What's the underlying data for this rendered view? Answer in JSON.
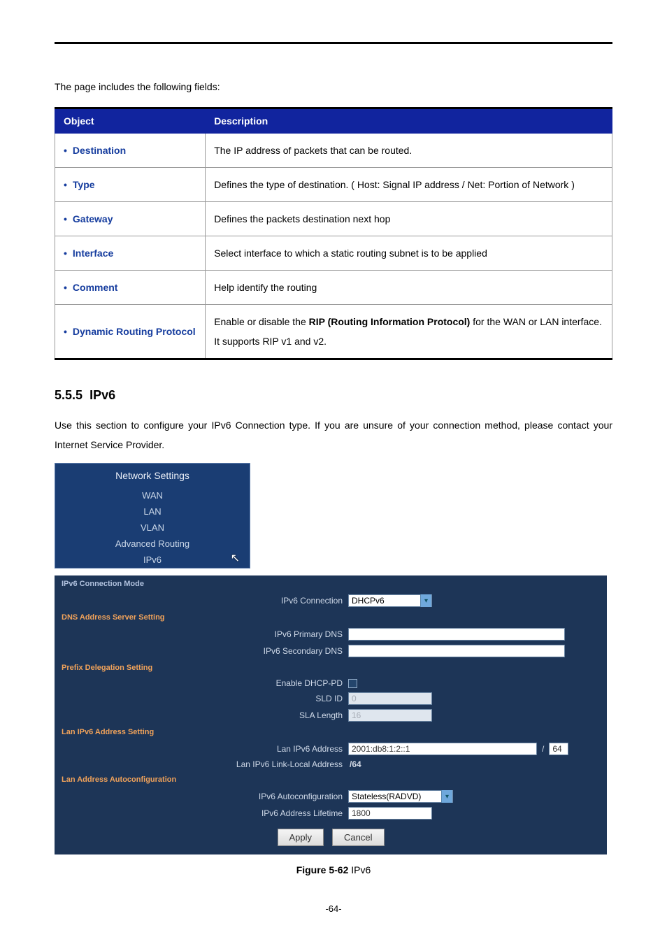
{
  "intro": "The page includes the following fields:",
  "tableHeader": {
    "object": "Object",
    "description": "Description"
  },
  "rows": [
    {
      "obj": "Destination",
      "desc": "The IP address of packets that can be routed."
    },
    {
      "obj": "Type",
      "desc_pre": "Defines the type of destination. ( Host: Signal IP address / Net: Portion of Network )"
    },
    {
      "obj": "Gateway",
      "desc": "Defines the packets destination next hop"
    },
    {
      "obj": "Interface",
      "desc": "Select interface to which a static routing subnet is to be applied"
    },
    {
      "obj": "Comment",
      "desc": "Help identify the routing"
    },
    {
      "obj": "Dynamic Routing Protocol",
      "desc_pre": "Enable or disable the ",
      "desc_bold": "RIP (Routing Information Protocol)",
      "desc_post": " for the WAN or LAN interface.",
      "desc_line2": "It supports RIP v1 and v2."
    }
  ],
  "section": {
    "number": "5.5.5",
    "title": "IPv6",
    "body": "Use this section to configure your IPv6 Connection type. If you are unsure of your connection method, please contact your Internet Service Provider."
  },
  "nav": {
    "header": "Network Settings",
    "items": [
      "WAN",
      "LAN",
      "VLAN",
      "Advanced Routing",
      "IPv6"
    ]
  },
  "panel": {
    "sec1": "IPv6 Connection Mode",
    "ipv6conn_label": "IPv6 Connection",
    "ipv6conn_value": "DHCPv6",
    "sec2": "DNS Address Server Setting",
    "dns1_label": "IPv6 Primary DNS",
    "dns2_label": "IPv6 Secondary DNS",
    "sec3": "Prefix Delegation Setting",
    "pd_label": "Enable DHCP-PD",
    "sld_label": "SLD ID",
    "sld_value": "0",
    "sla_label": "SLA Length",
    "sla_value": "16",
    "sec4": "Lan IPv6 Address Setting",
    "lan_addr_label": "Lan IPv6 Address",
    "lan_addr_value": "2001:db8:1:2::1",
    "lan_addr_suffix": "64",
    "lan_ll_label": "Lan IPv6 Link-Local Address",
    "lan_ll_value": "/64",
    "sec5": "Lan Address Autoconfiguration",
    "autoconf_label": "IPv6 Autoconfiguration",
    "autoconf_value": "Stateless(RADVD)",
    "lifetime_label": "IPv6 Address Lifetime",
    "lifetime_value": "1800",
    "apply": "Apply",
    "cancel": "Cancel"
  },
  "figure": {
    "label": "Figure 5-62",
    "caption": "IPv6"
  },
  "pagenum": "-64-"
}
